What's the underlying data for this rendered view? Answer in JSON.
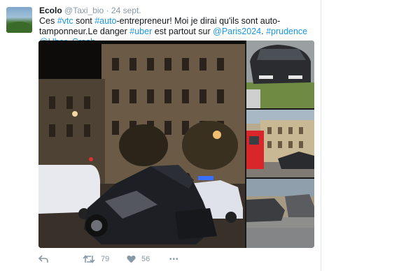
{
  "tweet": {
    "name": "Ecolo",
    "handle": "@Taxi_bio",
    "separator": "·",
    "date": "24 sept.",
    "text": {
      "t1": "Ces ",
      "h1": "#vtc",
      "t2": " sont ",
      "h2": "#auto",
      "t3": "-entrepreneur! Moi je dirai qu'ils sont auto-tamponneur.Le danger ",
      "h3": "#uber",
      "t4": " est partout sur ",
      "h4": "@Paris2024",
      "t5": ". ",
      "h5": "#prudence",
      "t6": " ",
      "h6": "@Uber_Crash"
    }
  },
  "actions": {
    "reply_icon": "reply-icon",
    "retweet_icon": "retweet-icon",
    "retweet_count": "79",
    "like_icon": "heart-icon",
    "like_count": "56",
    "more_icon": "more-icon",
    "more_label": "•••"
  },
  "colors": {
    "link": "#1b95e0",
    "icon": "#8899a6",
    "text": "#14171a"
  }
}
